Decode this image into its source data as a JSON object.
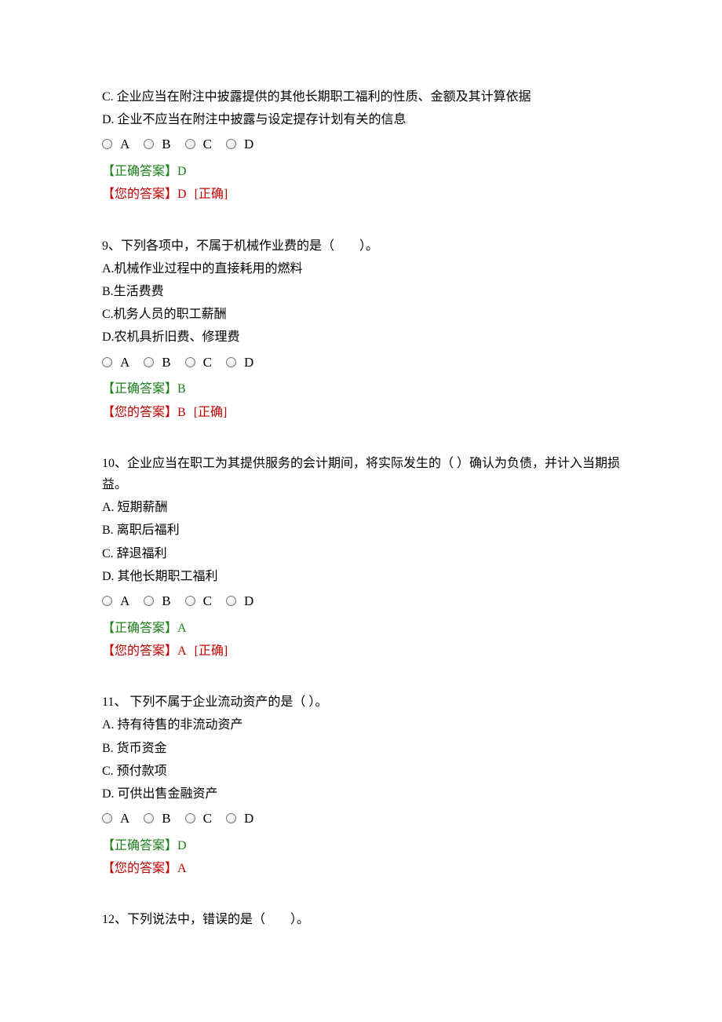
{
  "labels": {
    "correct_prefix": "【正确答案】",
    "user_prefix": "【您的答案】",
    "correct_tag": "[正确]"
  },
  "radio_letters": [
    "A",
    "B",
    "C",
    "D"
  ],
  "questions": [
    {
      "stem_lines": [
        "C.  企业应当在附注中披露提供的其他长期职工福利的性质、金额及其计算依据",
        "D.  企业不应当在附注中披露与设定提存计划有关的信息"
      ],
      "correct": "D",
      "user": "D",
      "is_correct": true
    },
    {
      "stem_lines": [
        "9、下列各项中，不属于机械作业费的是（　　）。",
        "A.机械作业过程中的直接耗用的燃料",
        "B.生活费费",
        "C.机务人员的职工薪酬",
        "D.农机具折旧费、修理费"
      ],
      "correct": "B",
      "user": "B",
      "is_correct": true
    },
    {
      "stem_lines": [
        "10、企业应当在职工为其提供服务的会计期间，将实际发生的（  ）确认为负债，并计入当期损益。",
        "A.  短期薪酬",
        "B.  离职后福利",
        "C.  辞退福利",
        "D.  其他长期职工福利"
      ],
      "correct": "A",
      "user": "A",
      "is_correct": true
    },
    {
      "stem_lines": [
        "11、 下列不属于企业流动资产的是（  ）。",
        "A.  持有待售的非流动资产",
        "B.  货币资金",
        "C.  预付款项",
        "D.  可供出售金融资产"
      ],
      "correct": "D",
      "user": "A",
      "is_correct": false
    },
    {
      "stem_lines": [
        "12、下列说法中，错误的是（　　）。"
      ],
      "no_radio": true
    }
  ]
}
